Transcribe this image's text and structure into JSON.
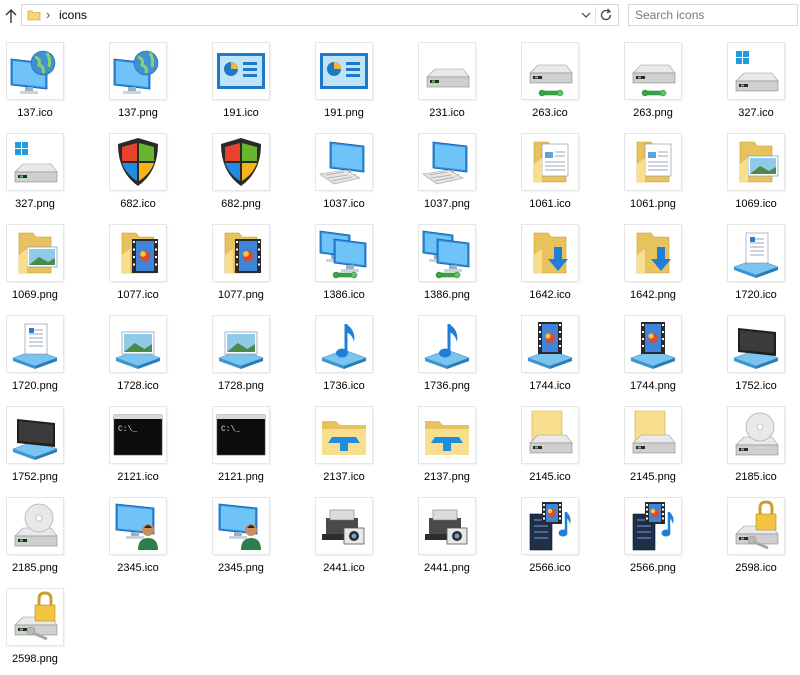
{
  "toolbar": {
    "breadcrumb": "icons",
    "search_placeholder": "Search icons"
  },
  "files": [
    {
      "name": "137.ico",
      "icon": "globe-monitor-icon"
    },
    {
      "name": "137.png",
      "icon": "globe-monitor-icon"
    },
    {
      "name": "191.ico",
      "icon": "control-panel-icon"
    },
    {
      "name": "191.png",
      "icon": "control-panel-icon"
    },
    {
      "name": "231.ico",
      "icon": "hard-drive-icon"
    },
    {
      "name": "263.ico",
      "icon": "network-drive-icon"
    },
    {
      "name": "263.png",
      "icon": "network-drive-icon"
    },
    {
      "name": "327.ico",
      "icon": "windows-drive-icon"
    },
    {
      "name": "327.png",
      "icon": "windows-drive-icon"
    },
    {
      "name": "682.ico",
      "icon": "windows-shield-icon"
    },
    {
      "name": "682.png",
      "icon": "windows-shield-icon"
    },
    {
      "name": "1037.ico",
      "icon": "computer-icon"
    },
    {
      "name": "1037.png",
      "icon": "computer-icon"
    },
    {
      "name": "1061.ico",
      "icon": "documents-folder-icon"
    },
    {
      "name": "1061.png",
      "icon": "documents-folder-icon"
    },
    {
      "name": "1069.ico",
      "icon": "pictures-folder-icon"
    },
    {
      "name": "1069.png",
      "icon": "pictures-folder-icon"
    },
    {
      "name": "1077.ico",
      "icon": "videos-folder-icon"
    },
    {
      "name": "1077.png",
      "icon": "videos-folder-icon"
    },
    {
      "name": "1386.ico",
      "icon": "network-computers-icon"
    },
    {
      "name": "1386.png",
      "icon": "network-computers-icon"
    },
    {
      "name": "1642.ico",
      "icon": "downloads-folder-icon"
    },
    {
      "name": "1642.png",
      "icon": "downloads-folder-icon"
    },
    {
      "name": "1720.ico",
      "icon": "document-library-icon"
    },
    {
      "name": "1720.png",
      "icon": "document-library-icon"
    },
    {
      "name": "1728.ico",
      "icon": "picture-library-icon"
    },
    {
      "name": "1728.png",
      "icon": "picture-library-icon"
    },
    {
      "name": "1736.ico",
      "icon": "music-library-icon"
    },
    {
      "name": "1736.png",
      "icon": "music-library-icon"
    },
    {
      "name": "1744.ico",
      "icon": "video-library-icon"
    },
    {
      "name": "1744.png",
      "icon": "video-library-icon"
    },
    {
      "name": "1752.ico",
      "icon": "tv-library-icon"
    },
    {
      "name": "1752.png",
      "icon": "tv-library-icon"
    },
    {
      "name": "2121.ico",
      "icon": "command-prompt-icon"
    },
    {
      "name": "2121.png",
      "icon": "command-prompt-icon"
    },
    {
      "name": "2137.ico",
      "icon": "quick-access-folder-icon"
    },
    {
      "name": "2137.png",
      "icon": "quick-access-folder-icon"
    },
    {
      "name": "2145.ico",
      "icon": "folder-drive-icon"
    },
    {
      "name": "2145.png",
      "icon": "folder-drive-icon"
    },
    {
      "name": "2185.ico",
      "icon": "cd-drive-icon"
    },
    {
      "name": "2185.png",
      "icon": "cd-drive-icon"
    },
    {
      "name": "2345.ico",
      "icon": "user-computer-icon"
    },
    {
      "name": "2345.png",
      "icon": "user-computer-icon"
    },
    {
      "name": "2441.ico",
      "icon": "scanner-camera-icon"
    },
    {
      "name": "2441.png",
      "icon": "scanner-camera-icon"
    },
    {
      "name": "2566.ico",
      "icon": "media-server-icon"
    },
    {
      "name": "2566.png",
      "icon": "media-server-icon"
    },
    {
      "name": "2598.ico",
      "icon": "locked-drive-icon"
    },
    {
      "name": "2598.png",
      "icon": "locked-drive-icon"
    }
  ]
}
